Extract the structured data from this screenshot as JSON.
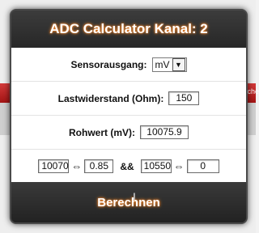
{
  "background": {
    "edge_text": "che"
  },
  "dialog": {
    "title": "ADC Calculator Kanal: 2",
    "sensor_output": {
      "label": "Sensorausgang:",
      "selected": "mV"
    },
    "load_resistance": {
      "label": "Lastwiderstand (Ohm):",
      "value": "150"
    },
    "raw_value": {
      "label": "Rohwert (mV):",
      "value": "10075.9"
    },
    "mapping": {
      "in_low": "10070",
      "out_low": "0.85",
      "conjunction": "&&",
      "in_high": "10550",
      "out_high": "0",
      "arrow": "⇔"
    },
    "calculate_label": "Berechnen"
  },
  "colors": {
    "accent_glow": "#ff8a2a",
    "dialog_bg": "#2b2b2b",
    "bg_redbar": "#c02525"
  }
}
